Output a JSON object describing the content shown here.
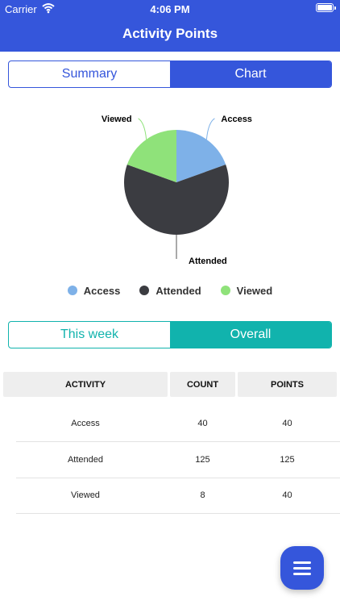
{
  "status_bar": {
    "carrier": "Carrier",
    "time": "4:06 PM"
  },
  "nav": {
    "title": "Activity Points"
  },
  "view_toggle": {
    "options": [
      "Summary",
      "Chart"
    ],
    "selected": "Chart"
  },
  "chart_data": {
    "type": "pie",
    "slices": [
      {
        "label": "Access",
        "value": 40,
        "color": "#7eb1e8"
      },
      {
        "label": "Attended",
        "value": 125,
        "color": "#3b3c41"
      },
      {
        "label": "Viewed",
        "value": 40,
        "color": "#8fe27a"
      }
    ],
    "legend_position": "bottom"
  },
  "period_toggle": {
    "options": [
      "This week",
      "Overall"
    ],
    "selected": "Overall"
  },
  "table": {
    "columns": [
      "ACTIVITY",
      "COUNT",
      "POINTS"
    ],
    "rows": [
      {
        "activity": "Access",
        "count": "40",
        "points": "40"
      },
      {
        "activity": "Attended",
        "count": "125",
        "points": "125"
      },
      {
        "activity": "Viewed",
        "count": "8",
        "points": "40"
      }
    ]
  },
  "fab": {
    "icon": "menu-icon"
  }
}
